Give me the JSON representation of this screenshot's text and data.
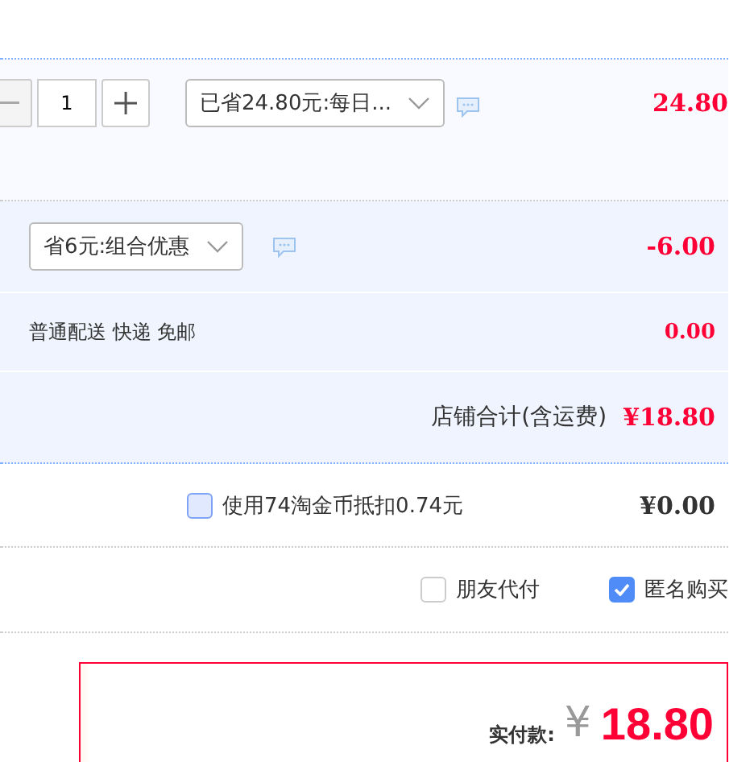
{
  "item": {
    "quantity": "1",
    "promo": "已省24.80元:每日...",
    "price": "24.80"
  },
  "combo": {
    "promo": "省6元:组合优惠",
    "amount": "-6.00"
  },
  "shipping": {
    "label": "普通配送 快递 免邮",
    "amount": "0.00"
  },
  "shop_total": {
    "label": "店铺合计(含运费)",
    "amount": "¥18.80"
  },
  "coins": {
    "label": "使用74淘金币抵扣0.74元",
    "checked": false,
    "amount": "¥0.00"
  },
  "options": [
    {
      "label": "朋友代付",
      "checked": false
    },
    {
      "label": "匿名购买",
      "checked": true
    }
  ],
  "payment": {
    "label": "实付款:",
    "currency": "¥",
    "amount": "18.80"
  }
}
